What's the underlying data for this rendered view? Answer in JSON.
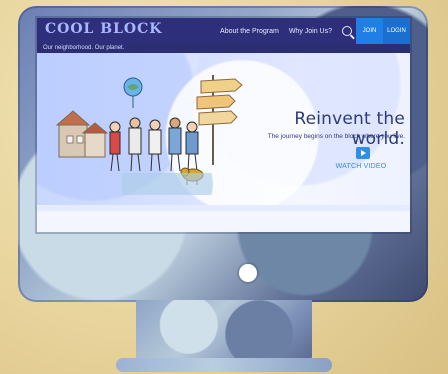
{
  "site": {
    "logo_text": "COOL BLOCK",
    "tagline": "Our neighborhood. Our planet."
  },
  "nav": {
    "items": [
      {
        "label": "About the Program"
      },
      {
        "label": "Why Join Us?"
      }
    ],
    "buttons": [
      {
        "label": "JOIN"
      },
      {
        "label": "LOGIN"
      }
    ]
  },
  "hero": {
    "title": "Reinvent the world.",
    "subtitle": "The journey begins on the block where you live.",
    "cta_label": "WATCH VIDEO"
  },
  "colors": {
    "nav_bg": "#2d2f7a",
    "accent_blue": "#2e8ee8",
    "headline": "#2c3a7a"
  }
}
